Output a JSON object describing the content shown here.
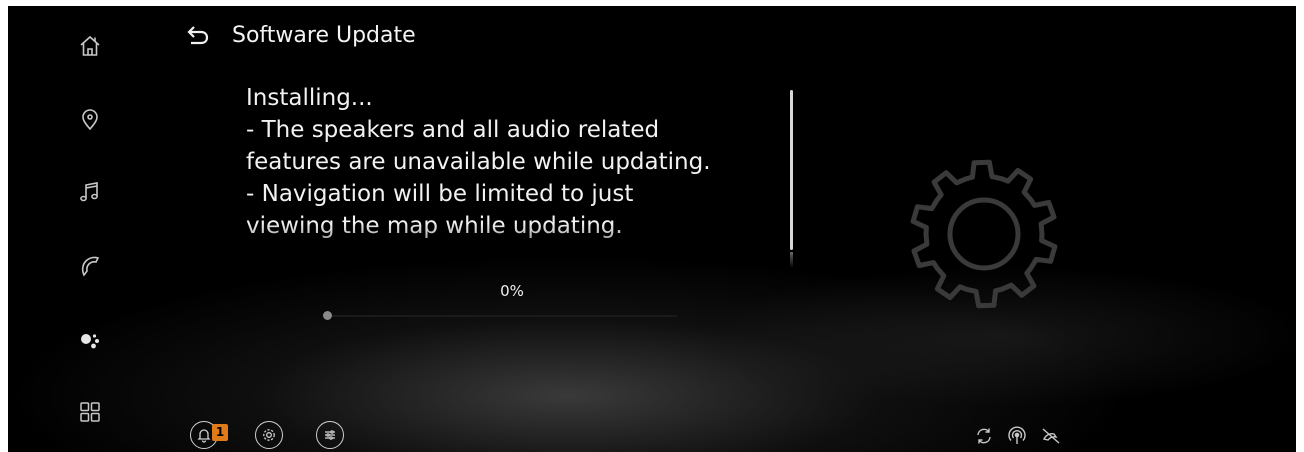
{
  "header": {
    "back_icon": "back-arrow-icon",
    "title": "Software Update"
  },
  "sidebar": {
    "items": [
      {
        "icon": "home-icon"
      },
      {
        "icon": "location-pin-icon"
      },
      {
        "icon": "music-note-icon"
      },
      {
        "icon": "phone-icon"
      },
      {
        "icon": "google-assistant-icon"
      },
      {
        "icon": "app-grid-icon"
      }
    ]
  },
  "message": {
    "lines": [
      "Installing...",
      "- The speakers and all audio related",
      "features are unavailable while updating.",
      "- Navigation will be limited to just",
      "viewing the map while updating."
    ]
  },
  "progress": {
    "text": "0%",
    "value": 0
  },
  "bottom_bar": {
    "notification_icon": "bell-icon",
    "notification_count": "1",
    "settings_icon": "gear-icon",
    "controls_icon": "sliders-icon",
    "status_icons": [
      "sync-icon",
      "wireless-signal-icon",
      "phone-disconnected-icon"
    ]
  },
  "colors": {
    "background": "#000000",
    "text": "#f2f2f2",
    "badge": "#e07b1a",
    "icon": "#c8c8c8"
  }
}
